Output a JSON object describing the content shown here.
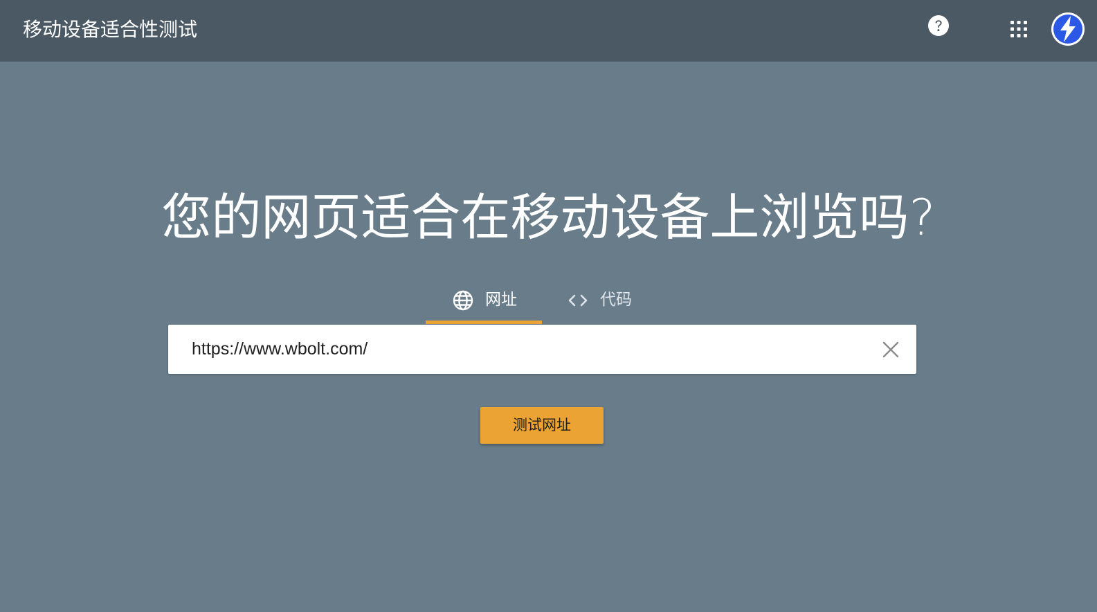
{
  "header": {
    "title": "移动设备适合性测试",
    "help_icon": "help-circle-icon",
    "apps_icon": "apps-grid-icon",
    "avatar_icon": "lightning-bolt-avatar-icon"
  },
  "main": {
    "headline": "您的网页适合在移动设备上浏览吗?",
    "tabs": [
      {
        "label": "网址",
        "icon": "globe-icon",
        "selected": true
      },
      {
        "label": "代码",
        "icon": "code-brackets-icon",
        "selected": false
      }
    ],
    "url_input": {
      "value": "https://www.wbolt.com/"
    },
    "clear_icon": "close-icon",
    "submit_label": "测试网址"
  },
  "colors": {
    "header_bg": "#4a5963",
    "page_bg": "#697c8a",
    "accent": "#eba334",
    "avatar_blue": "#2b59e6"
  }
}
